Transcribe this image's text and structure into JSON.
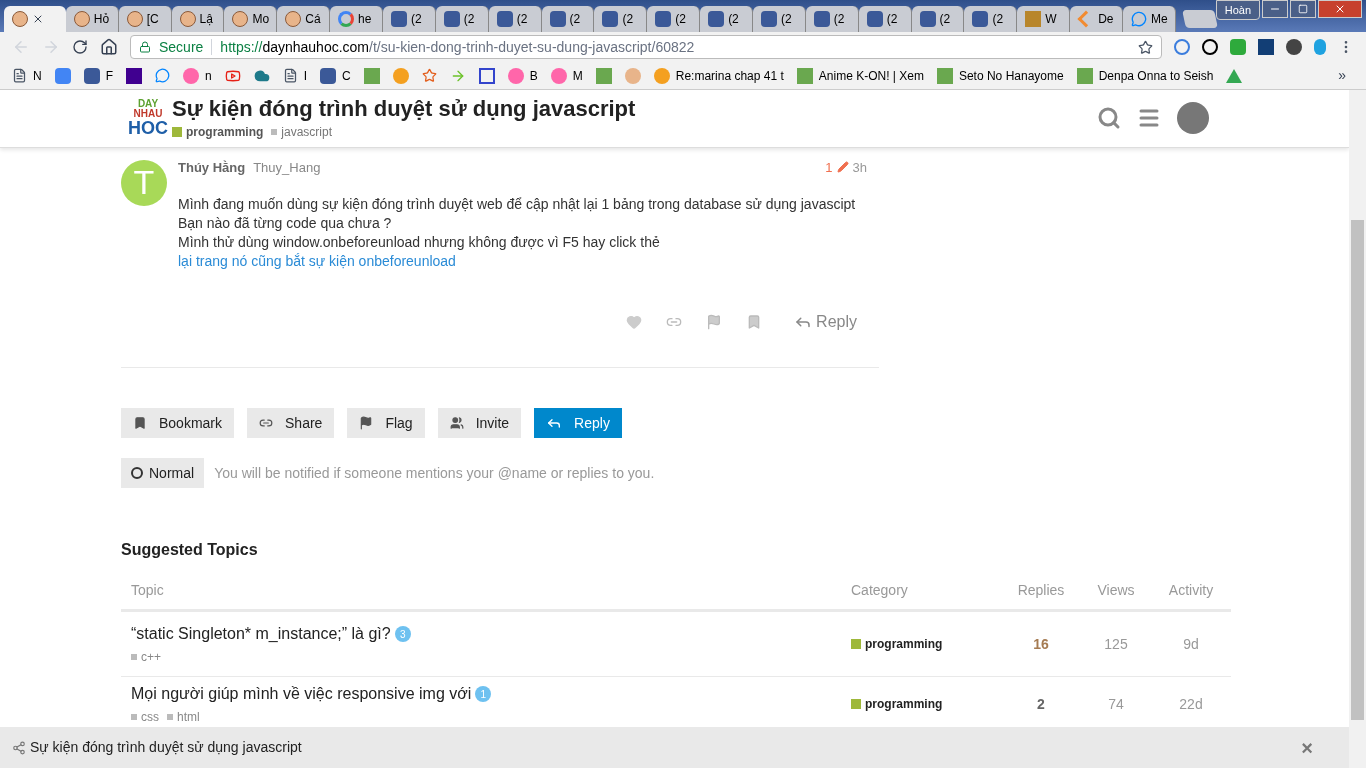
{
  "browser": {
    "tabs": [
      {
        "kind": "face",
        "selected": true
      },
      {
        "kind": "face",
        "title": "Hỏ",
        "selected": false
      },
      {
        "kind": "face",
        "title": "[C",
        "selected": false
      },
      {
        "kind": "face",
        "title": "Lậ",
        "selected": false
      },
      {
        "kind": "face",
        "title": "Mo",
        "selected": false
      },
      {
        "kind": "face",
        "title": "Cá",
        "selected": false
      },
      {
        "kind": "google",
        "title": "he",
        "selected": false
      },
      {
        "kind": "facebook",
        "title": "(2",
        "selected": false
      },
      {
        "kind": "facebook",
        "title": "(2",
        "selected": false
      },
      {
        "kind": "facebook",
        "title": "(2",
        "selected": false
      },
      {
        "kind": "facebook",
        "title": "(2",
        "selected": false
      },
      {
        "kind": "facebook",
        "title": "(2",
        "selected": false
      },
      {
        "kind": "facebook",
        "title": "(2",
        "selected": false
      },
      {
        "kind": "facebook",
        "title": "(2",
        "selected": false
      },
      {
        "kind": "facebook",
        "title": "(2",
        "selected": false
      },
      {
        "kind": "facebook",
        "title": "(2",
        "selected": false
      },
      {
        "kind": "facebook",
        "title": "(2",
        "selected": false
      },
      {
        "kind": "facebook",
        "title": "(2",
        "selected": false
      },
      {
        "kind": "facebook",
        "title": "(2",
        "selected": false
      },
      {
        "kind": "square",
        "title": "W",
        "selected": false
      },
      {
        "kind": "chevron",
        "title": "De",
        "selected": false
      },
      {
        "kind": "messenger",
        "title": "Me",
        "selected": false
      }
    ],
    "profile": "Hoàn",
    "secure": "Secure",
    "url_scheme": "https://",
    "url_host": "daynhauhoc.com",
    "url_path": "/t/su-kien-dong-trinh-duyet-su-dung-javascript/60822",
    "bookmarks": [
      {
        "kind": "page",
        "label": "N"
      },
      {
        "kind": "translate"
      },
      {
        "kind": "facebook",
        "label": "F"
      },
      {
        "kind": "yahoo"
      },
      {
        "kind": "messenger"
      },
      {
        "kind": "osu",
        "label": "n"
      },
      {
        "kind": "youtube"
      },
      {
        "kind": "cloud"
      },
      {
        "kind": "page",
        "label": "I"
      },
      {
        "kind": "facebook",
        "label": "C"
      },
      {
        "kind": "square"
      },
      {
        "kind": "circle"
      },
      {
        "kind": "star"
      },
      {
        "kind": "arrow"
      },
      {
        "kind": "sigma"
      },
      {
        "kind": "osu",
        "label": "B"
      },
      {
        "kind": "osu",
        "label": "M"
      },
      {
        "kind": "square"
      },
      {
        "kind": "face"
      },
      {
        "kind": "circle",
        "label": "Re:marina chap 41 t"
      },
      {
        "kind": "square",
        "label": "Anime K-ON! | Xem"
      },
      {
        "kind": "square",
        "label": "Seto No Hanayome"
      },
      {
        "kind": "square",
        "label": "Denpa Onna to Seish"
      },
      {
        "kind": "drive"
      }
    ],
    "more": "»"
  },
  "header": {
    "logo_top": "DAY",
    "logo_mid": "NHAU",
    "logo_bottom": "HOC",
    "title": "Sự kiện đóng trình duyệt sử dụng javascript",
    "category": "programming",
    "tag": "javascript"
  },
  "post": {
    "avatar_letter": "T",
    "name": "Thúy Hằng",
    "username": "Thuy_Hang",
    "edits": "1",
    "age": "3h",
    "lines": [
      "Mình đang muốn dùng sự kiện đóng trình duyệt web để cập nhật lại 1 bảng trong database sử dụng javascipt",
      "Bạn nào đã từng code qua chưa ?"
    ],
    "last_line": "Mình thử dùng window.onbeforeunload nhưng không được vì F5 hay click thẻ",
    "link": "lại trang nó cũng bắt sự kiện onbeforeunload",
    "reply": "Reply"
  },
  "buttons": [
    {
      "kind": "bookmark",
      "label": "Bookmark",
      "primary": false
    },
    {
      "kind": "share",
      "label": "Share",
      "primary": false
    },
    {
      "kind": "flag",
      "label": "Flag",
      "primary": false
    },
    {
      "kind": "invite",
      "label": "Invite",
      "primary": false
    },
    {
      "kind": "reply",
      "label": "Reply",
      "primary": true
    }
  ],
  "notification": {
    "level": "Normal",
    "text": "You will be notified if someone mentions your @name or replies to you."
  },
  "suggested": {
    "title": "Suggested Topics",
    "columns": [
      "Topic",
      "Category",
      "Replies",
      "Views",
      "Activity"
    ],
    "rows": [
      {
        "title": "“static Singleton* m_instance;” là gì?",
        "unread": "3",
        "tags": [
          "c++"
        ],
        "category": "programming",
        "replies": "16",
        "hot": true,
        "views": "125",
        "activity": "9d"
      },
      {
        "title": "Mọi người giúp mình về việc responsive img với",
        "unread": "1",
        "tags": [
          "css",
          "html"
        ],
        "category": "programming",
        "replies": "2",
        "hot": false,
        "views": "74",
        "activity": "22d"
      }
    ]
  },
  "reply_bar": {
    "text": "Sự kiện đóng trình duyệt sử dụng javascript",
    "close": "×"
  }
}
